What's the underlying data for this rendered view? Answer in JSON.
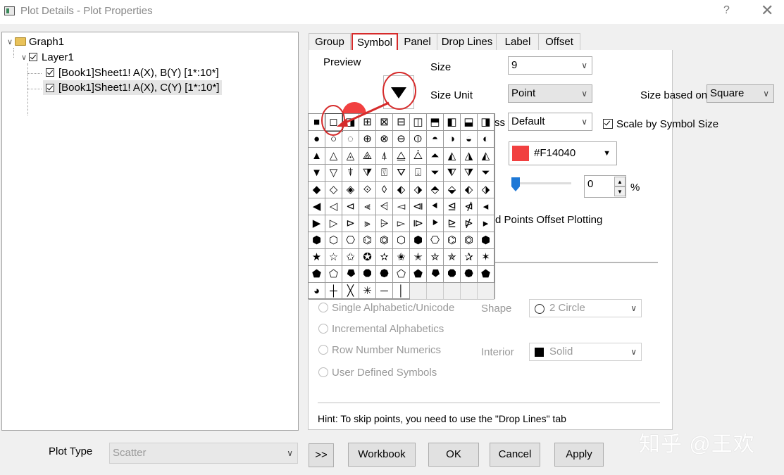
{
  "window": {
    "title": "Plot Details - Plot Properties",
    "help_icon": "?",
    "close_icon": "close-icon"
  },
  "tree": {
    "graph": "Graph1",
    "layer": "Layer1",
    "plots": [
      "[Book1]Sheet1! A(X), B(Y) [1*:10*]",
      "[Book1]Sheet1! A(X), C(Y) [1*:10*]"
    ]
  },
  "tabs": [
    "Group",
    "Symbol",
    "Panel",
    "Drop Lines",
    "Label",
    "Offset"
  ],
  "symbol": {
    "preview_label": "Preview",
    "size_label": "Size",
    "size_value": "9",
    "size_unit_label": "Size Unit",
    "size_unit_value": "Point",
    "size_based_on_label": "Size based on",
    "size_based_on_value": "Square",
    "thickness_label_tail": "ss",
    "thickness_value": "Default",
    "scale_by_symbol_label": "Scale by Symbol Size",
    "color_value": "#F14040",
    "transparency_value": "0",
    "percent": "%",
    "offset_plotting_tail": "d Points Offset Plotting",
    "radio_options": [
      "Single Alphabetic/Unicode",
      "Incremental Alphabetics",
      "Row Number Numerics",
      "User Defined Symbols"
    ],
    "shape_label": "Shape",
    "shape_value": "2 Circle",
    "interior_label": "Interior",
    "interior_value": "Solid",
    "hint": "Hint: To skip points, you need to use the \"Drop Lines\" tab"
  },
  "symbol_grid": [
    [
      "■",
      "◻",
      "◨",
      "⊞",
      "⊠",
      "⊟",
      "◫",
      "⬒",
      "◧",
      "⬓",
      "◨"
    ],
    [
      "●",
      "○",
      "◌",
      "⊕",
      "⊗",
      "⊖",
      "⦶",
      "◓",
      "◑",
      "◒",
      "◐"
    ],
    [
      "▲",
      "△",
      "◬",
      "⟁",
      "⍋",
      "⧋",
      "⧊",
      "⏶",
      "◭",
      "◮",
      "◭"
    ],
    [
      "▼",
      "▽",
      "⍒",
      "⧩",
      "⍔",
      "⛛",
      "⍗",
      "⏷",
      "⧨",
      "⧩",
      "⏷"
    ],
    [
      "◆",
      "◇",
      "◈",
      "⟐",
      "◊",
      "⬖",
      "⬗",
      "⬘",
      "⬙",
      "⬖",
      "⬗"
    ],
    [
      "◀",
      "◁",
      "⊲",
      "⫷",
      "⩤",
      "◅",
      "⧏",
      "⯇",
      "⊴",
      "⋪",
      "◂"
    ],
    [
      "▶",
      "▷",
      "⊳",
      "⫸",
      "⩥",
      "▻",
      "⧐",
      "⯈",
      "⊵",
      "⋫",
      "▸"
    ],
    [
      "⬢",
      "⬡",
      "⎔",
      "⌬",
      "⏣",
      "⬡",
      "⬢",
      "⎔",
      "⌬",
      "⏣",
      "⬢"
    ],
    [
      "★",
      "☆",
      "✩",
      "✪",
      "✫",
      "✬",
      "✭",
      "✮",
      "✯",
      "✰",
      "✶"
    ],
    [
      "⬟",
      "⬠",
      "⯂",
      "⯃",
      "⯄",
      "⬠",
      "⬟",
      "⯂",
      "⯃",
      "⯄",
      "⬟"
    ],
    [
      "◕",
      "┼",
      "╳",
      "✳",
      "─",
      "│",
      "",
      "",
      "",
      "",
      ""
    ]
  ],
  "bottom": {
    "plot_type_label": "Plot Type",
    "plot_type_value": "Scatter",
    "expand": ">>",
    "workbook": "Workbook",
    "ok": "OK",
    "cancel": "Cancel",
    "apply": "Apply"
  },
  "watermark": "知乎 @王欢",
  "colors": {
    "annotation_red": "#d62b2b",
    "symbol_color": "#F14040",
    "slider_blue": "#1e78d6"
  }
}
